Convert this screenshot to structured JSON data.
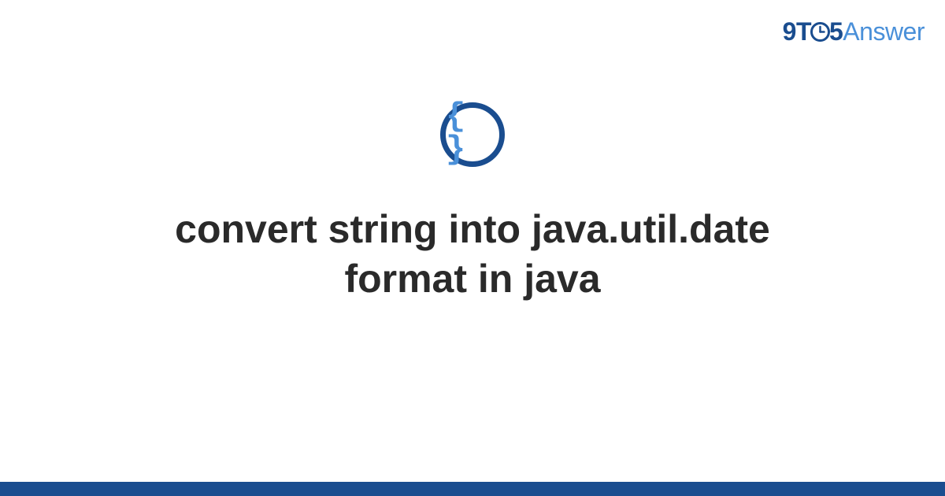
{
  "logo": {
    "part1": "9",
    "part2": "T",
    "part3": "5",
    "part4": "Answer"
  },
  "icon": {
    "name": "code-braces-icon",
    "glyph": "{ }"
  },
  "title": "convert string into java.util.date format in java",
  "colors": {
    "dark_blue": "#1a4d8f",
    "light_blue": "#4a90d9",
    "text": "#2a2a2a"
  }
}
